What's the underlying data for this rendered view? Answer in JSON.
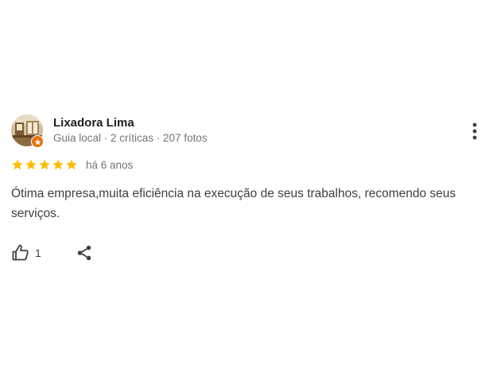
{
  "review": {
    "author": {
      "name": "Lixadora Lima",
      "meta": "Guia local · 2 críticas · 207 fotos",
      "avatar_icon": "profile-photo",
      "badge_icon": "local-guide-star-icon",
      "badge_color": "#e8710a"
    },
    "rating": {
      "stars": 5,
      "max_stars": 5,
      "star_color": "#fbbc04",
      "time_ago": "há 6 anos"
    },
    "text": "Ótima empresa,muita eficiência na execução de seus trabalhos, recomendo seus serviços.",
    "actions": {
      "like_icon": "thumb-up-icon",
      "like_count": "1",
      "share_icon": "share-icon",
      "more_icon": "more-vertical-icon"
    }
  }
}
